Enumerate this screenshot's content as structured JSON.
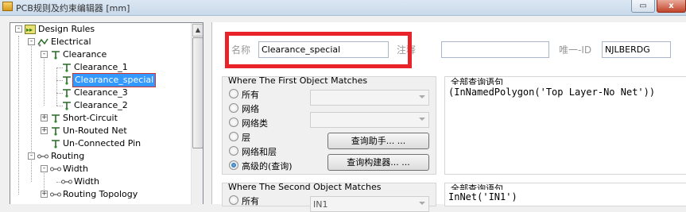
{
  "window": {
    "title": "PCB规则及约束编辑器 [mm]",
    "close_label": "x"
  },
  "tree": {
    "items": [
      {
        "label": "Design Rules",
        "icon": "design-rules-icon",
        "expander": "-"
      },
      {
        "label": "Electrical",
        "icon": "electrical-icon",
        "expander": "-"
      },
      {
        "label": "Clearance",
        "icon": "clearance-icon",
        "expander": "-"
      },
      {
        "label": "Clearance_1",
        "icon": "clearance-rule-icon"
      },
      {
        "label": "Clearance_special",
        "icon": "clearance-rule-icon",
        "selected": true
      },
      {
        "label": "Clearance_3",
        "icon": "clearance-rule-icon"
      },
      {
        "label": "Clearance_2",
        "icon": "clearance-rule-icon"
      },
      {
        "label": "Short-Circuit",
        "icon": "short-circuit-icon",
        "expander": "+"
      },
      {
        "label": "Un-Routed Net",
        "icon": "unrouted-net-icon",
        "expander": "+"
      },
      {
        "label": "Un-Connected Pin",
        "icon": "unconnected-pin-icon"
      },
      {
        "label": "Routing",
        "icon": "routing-icon",
        "expander": "-"
      },
      {
        "label": "Width",
        "icon": "width-icon",
        "expander": "-"
      },
      {
        "label": "Width",
        "icon": "width-rule-icon"
      },
      {
        "label": "Routing Topology",
        "icon": "routing-topology-icon",
        "expander": "+"
      }
    ]
  },
  "rule": {
    "name_label": "名称",
    "name_value": "Clearance_special",
    "comment_label": "注释",
    "comment_value": "",
    "id_label": "唯一-ID",
    "id_value": "NJLBERDG"
  },
  "first_match": {
    "title": "Where The First Object Matches",
    "options": [
      "所有",
      "网络",
      "网络类",
      "层",
      "网络和层",
      "高级的(查询)"
    ],
    "selected_index": 5,
    "query_helper_button": "查询助手... ...",
    "query_builder_button": "查询构建器... ...",
    "full_query_label": "全部查询语句",
    "full_query": "(InNamedPolygon('Top Layer-No Net'))"
  },
  "second_match": {
    "title": "Where The Second Object Matches",
    "first_option": "所有",
    "combo_value": "IN1",
    "full_query_label": "全部查询语句",
    "full_query": "InNet('IN1')"
  },
  "colors": {
    "highlight": "#e8232a",
    "selection": "#3399ff"
  }
}
